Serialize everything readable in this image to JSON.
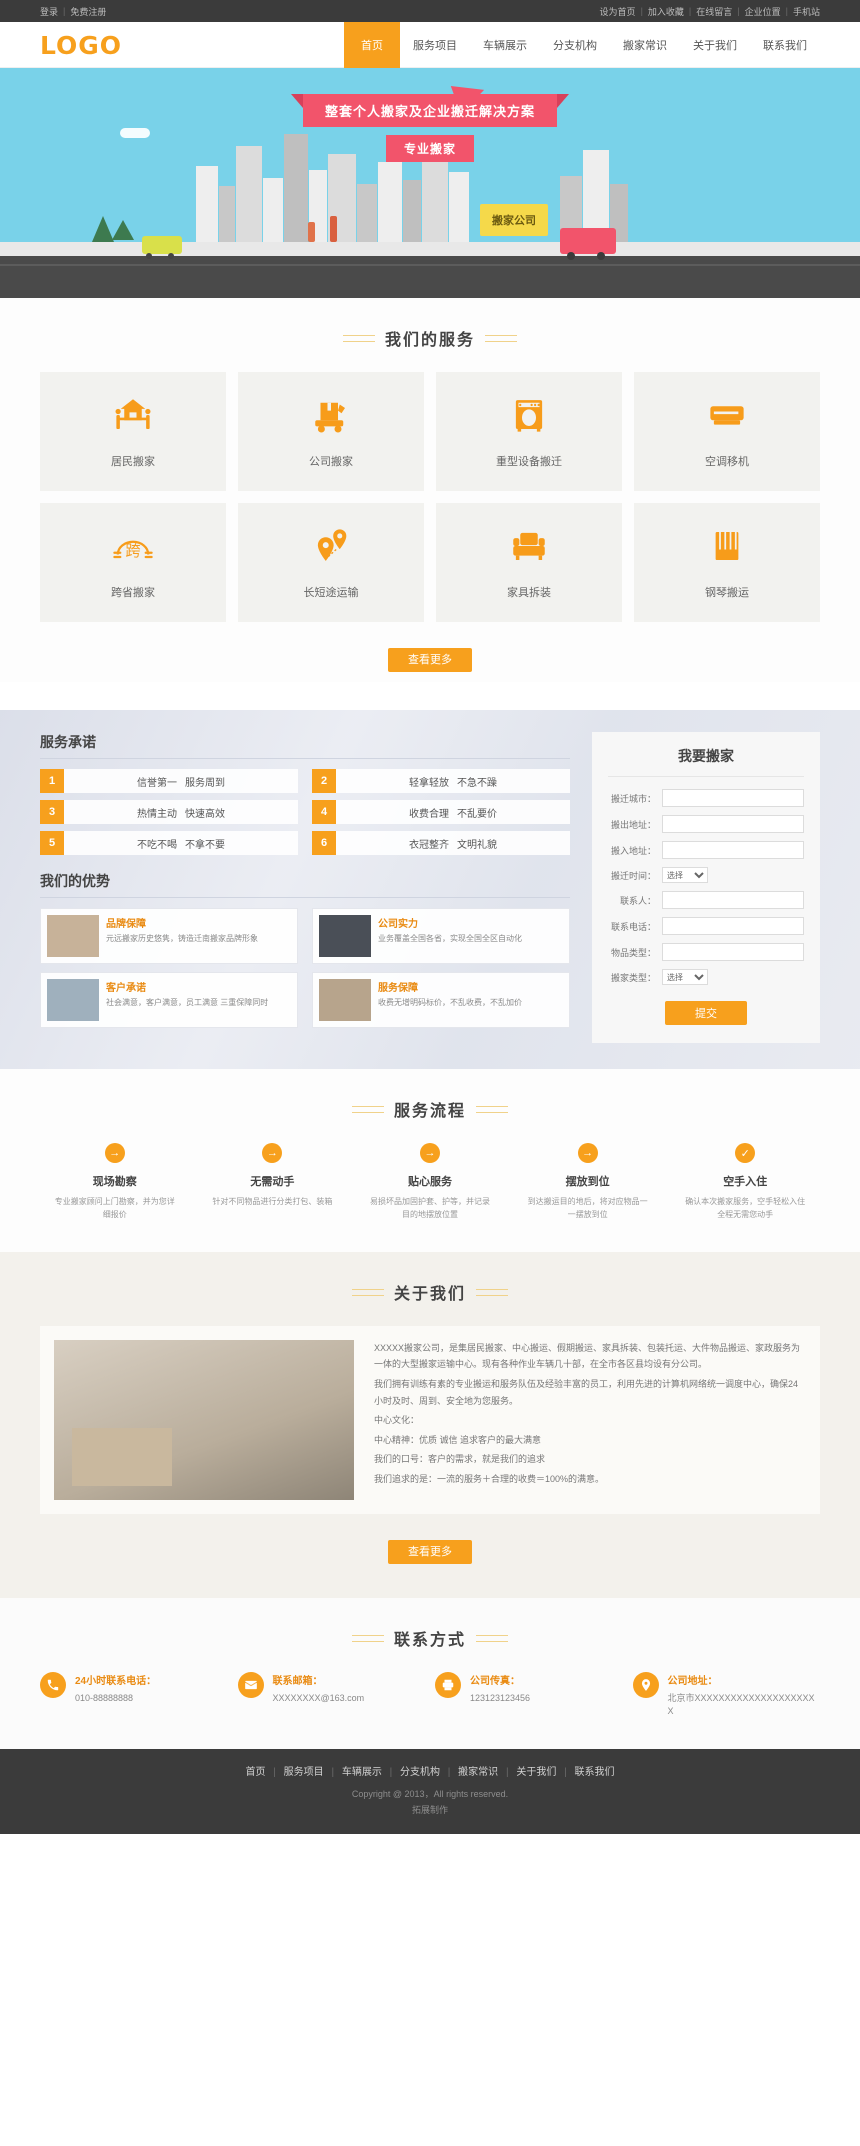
{
  "topbar": {
    "left_links": [
      "登录",
      "免费注册"
    ],
    "right_links": [
      "设为首页",
      "加入收藏",
      "在线留言",
      "企业位置",
      "手机站"
    ]
  },
  "header": {
    "logo": "LOGO",
    "nav": [
      {
        "label": "首页",
        "active": true
      },
      {
        "label": "服务项目",
        "active": false
      },
      {
        "label": "车辆展示",
        "active": false
      },
      {
        "label": "分支机构",
        "active": false
      },
      {
        "label": "搬家常识",
        "active": false
      },
      {
        "label": "关于我们",
        "active": false
      },
      {
        "label": "联系我们",
        "active": false
      }
    ]
  },
  "banner": {
    "headline": "整套个人搬家及企业搬迁解决方案",
    "subline": "专业搬家",
    "truck_sign": "搬家公司",
    "bg_color": "#79d2e9",
    "ribbon_color": "#f2546b"
  },
  "services": {
    "title": "我们的服务",
    "items": [
      {
        "label": "居民搬家",
        "icon": "house-movers-icon"
      },
      {
        "label": "公司搬家",
        "icon": "box-cart-icon"
      },
      {
        "label": "重型设备搬迁",
        "icon": "washing-machine-icon"
      },
      {
        "label": "空调移机",
        "icon": "air-conditioner-icon"
      },
      {
        "label": "跨省搬家",
        "icon": "cross-province-icon"
      },
      {
        "label": "长短途运输",
        "icon": "map-pins-icon"
      },
      {
        "label": "家具拆装",
        "icon": "sofa-icon"
      },
      {
        "label": "钢琴搬运",
        "icon": "piano-icon"
      }
    ],
    "more_label": "查看更多"
  },
  "promise": {
    "title": "服务承诺",
    "items": [
      {
        "num": "1",
        "a": "信誉第一",
        "b": "服务周到"
      },
      {
        "num": "2",
        "a": "轻拿轻放",
        "b": "不急不躁"
      },
      {
        "num": "3",
        "a": "热情主动",
        "b": "快速高效"
      },
      {
        "num": "4",
        "a": "收费合理",
        "b": "不乱要价"
      },
      {
        "num": "5",
        "a": "不吃不喝",
        "b": "不拿不要"
      },
      {
        "num": "6",
        "a": "衣冠整齐",
        "b": "文明礼貌"
      }
    ]
  },
  "advantage": {
    "title": "我们的优势",
    "items": [
      {
        "head": "品牌保障",
        "body": "元远搬家历史悠隽，铸造迁南搬家品牌形象"
      },
      {
        "head": "公司实力",
        "body": "业务覆盖全国各省，实现全国全区自动化"
      },
      {
        "head": "客户承诺",
        "body": "社会满意，客户满意，员工满意 三重保障同时"
      },
      {
        "head": "服务保障",
        "body": "收费无增明码标价，不乱收费，不乱加价"
      }
    ]
  },
  "form": {
    "title": "我要搬家",
    "fields": [
      {
        "label": "搬迁城市：",
        "type": "text",
        "value": ""
      },
      {
        "label": "搬出地址：",
        "type": "text",
        "value": ""
      },
      {
        "label": "搬入地址：",
        "type": "text",
        "value": ""
      },
      {
        "label": "搬迁时间：",
        "type": "select",
        "value": "选择"
      },
      {
        "label": "联系人：",
        "type": "text",
        "value": ""
      },
      {
        "label": "联系电话：",
        "type": "text",
        "value": ""
      },
      {
        "label": "物品类型：",
        "type": "text",
        "value": ""
      },
      {
        "label": "搬家类型：",
        "type": "select",
        "value": "选择"
      }
    ],
    "submit_label": "提交"
  },
  "process": {
    "title": "服务流程",
    "steps": [
      {
        "icon": "arrow-right-icon",
        "head": "现场勘察",
        "body": "专业搬家顾问上门勘察，并为您详细报价"
      },
      {
        "icon": "arrow-right-icon",
        "head": "无需动手",
        "body": "针对不同物品进行分类打包、装箱"
      },
      {
        "icon": "arrow-right-icon",
        "head": "贴心服务",
        "body": "易损坏品加固护套、护等，并记录目的地摆放位置"
      },
      {
        "icon": "arrow-right-icon",
        "head": "摆放到位",
        "body": "到达搬运目的地后，将对应物品一一摆放到位"
      },
      {
        "icon": "check-icon",
        "head": "空手入住",
        "body": "确认本次搬家服务，空手轻松入住全程无需您动手"
      }
    ]
  },
  "about": {
    "title": "关于我们",
    "image_alt": "搬家工人搬运纸箱",
    "paragraphs": [
      "XXXXX搬家公司，是集居民搬家、中心搬运、假期搬运、家具拆装、包装托运、大件物品搬运、家政服务为一体的大型搬家运输中心。现有各种作业车辆几十部，在全市各区县均设有分公司。",
      "我们拥有训练有素的专业搬运和服务队伍及经验丰富的员工，利用先进的计算机网络统一调度中心，确保24小时及时、周到、安全地为您服务。",
      "中心文化：",
      "中心精神：优质 诚信 追求客户的最大满意",
      "我们的口号：客户的需求，就是我们的追求",
      "我们追求的是：一流的服务＋合理的收费＝100%的满意。"
    ],
    "more_label": "查看更多"
  },
  "contact": {
    "title": "联系方式",
    "items": [
      {
        "icon": "phone-icon",
        "head": "24小时联系电话：",
        "value": "010-88888888"
      },
      {
        "icon": "mail-icon",
        "head": "联系邮箱：",
        "value": "XXXXXXXX@163.com"
      },
      {
        "icon": "fax-icon",
        "head": "公司传真：",
        "value": "123123123456"
      },
      {
        "icon": "location-icon",
        "head": "公司地址：",
        "value": "北京市XXXXXXXXXXXXXXXXXXXXX"
      }
    ]
  },
  "footer": {
    "nav": [
      "首页",
      "服务项目",
      "车辆展示",
      "分支机构",
      "搬家常识",
      "关于我们",
      "联系我们"
    ],
    "copyright": "Copyright @ 2013，All rights reserved.",
    "builder": "拓展制作"
  }
}
